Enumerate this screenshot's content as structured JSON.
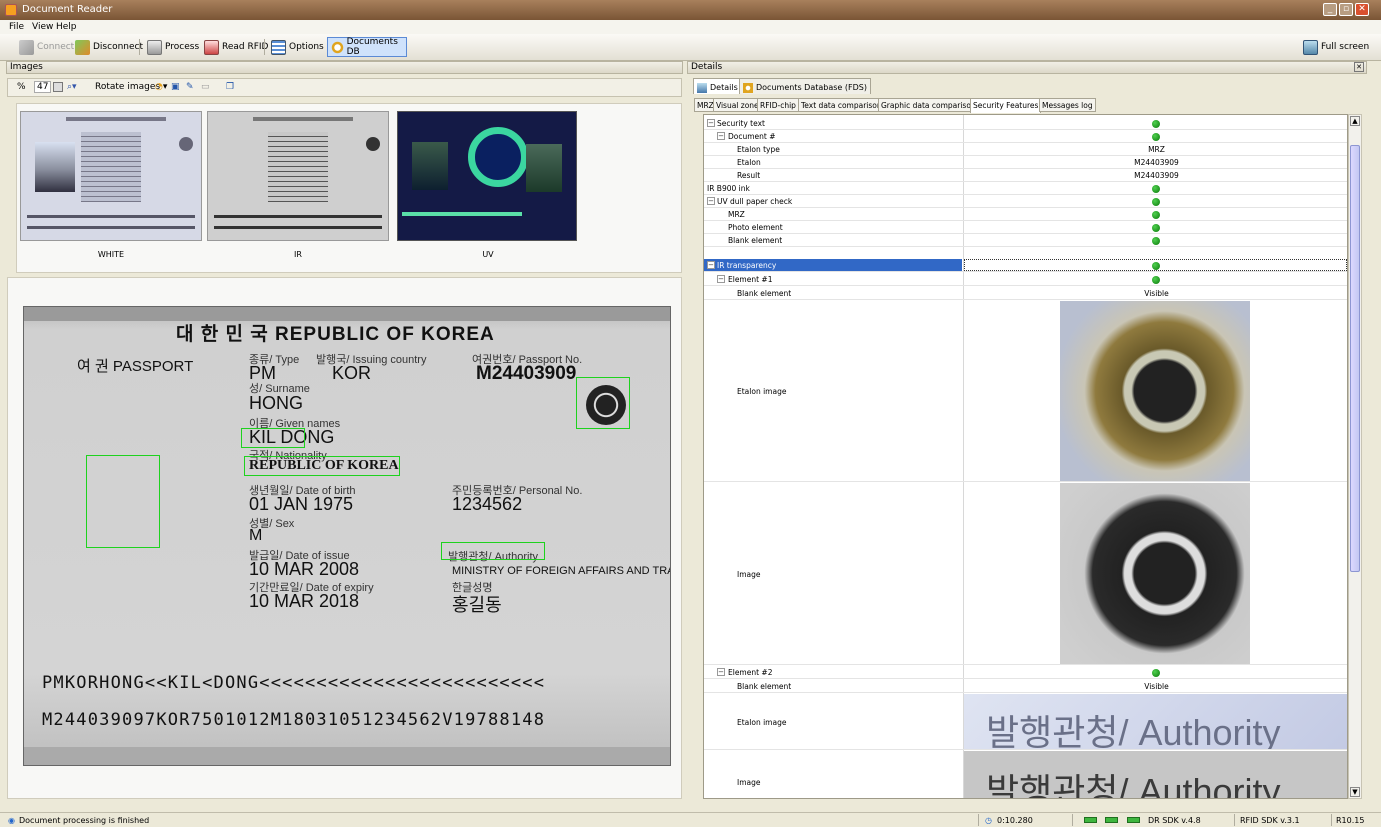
{
  "window": {
    "title": "Document Reader"
  },
  "menu": [
    "File",
    "View",
    "Help"
  ],
  "toolbar": {
    "connect": "Connect",
    "disconnect": "Disconnect",
    "process": "Process",
    "read_rfid": "Read RFID",
    "options": "Options",
    "documents_db": "Documents DB",
    "full_screen": "Full screen"
  },
  "images_panel": {
    "title": "Images",
    "zoom_prefix": "%",
    "zoom_value": "47",
    "rotate_label": "Rotate images ▾",
    "thumbnails": [
      {
        "label": "WHITE"
      },
      {
        "label": "IR"
      },
      {
        "label": "UV"
      }
    ]
  },
  "passport": {
    "country_header": "대 한 민 국   REPUBLIC OF KOREA",
    "doc_title": "여 권  PASSPORT",
    "type_label": "종류/ Type",
    "type_value": "PM",
    "issuing_label": "발행국/ Issuing country",
    "issuing_value": "KOR",
    "passport_no_label": "여권번호/ Passport No.",
    "passport_no_value": "M24403909",
    "surname_label": "성/ Surname",
    "surname_value": "HONG",
    "given_label": "이름/ Given names",
    "given_value": "KIL DONG",
    "nationality_label": "국적/ Nationality",
    "nationality_value": "REPUBLIC OF KOREA",
    "dob_label": "생년월일/ Date of birth",
    "dob_value": "01 JAN 1975",
    "personal_label": "주민등록번호/ Personal No.",
    "personal_value": "1234562",
    "sex_label": "성별/ Sex",
    "sex_value": "M",
    "issue_label": "발급일/ Date of issue",
    "issue_value": "10 MAR 2008",
    "authority_label": "발행관청/ Authority",
    "authority_value": "MINISTRY OF FOREIGN AFFAIRS AND TRADE",
    "expiry_label": "기간만료일/ Date of expiry",
    "expiry_value": "10 MAR 2018",
    "korean_name_label": "한글성명",
    "korean_name_value": "홍길동",
    "mrz1": "PMKORHONG<<KIL<DONG<<<<<<<<<<<<<<<<<<<<<<<<<",
    "mrz2": "M244039097KOR7501012M18031051234562V19788148"
  },
  "details_panel": {
    "title": "Details",
    "tabs": [
      "Details",
      "Documents Database (FDS)"
    ],
    "subtabs": [
      "MRZ",
      "Visual zone",
      "RFID-chip",
      "Text data comparison",
      "Graphic data comparison",
      "Security Features",
      "Messages log"
    ],
    "rows": [
      {
        "label": "Security text",
        "value": "",
        "ok": true
      },
      {
        "label": "Document #",
        "value": "",
        "ok": true
      },
      {
        "label": "Etalon type",
        "value": "MRZ",
        "ok": false
      },
      {
        "label": "Etalon",
        "value": "M24403909",
        "ok": false
      },
      {
        "label": "Result",
        "value": "M24403909",
        "ok": false
      },
      {
        "label": "IR B900 ink",
        "value": "",
        "ok": true
      },
      {
        "label": "UV dull paper check",
        "value": "",
        "ok": true
      },
      {
        "label": "MRZ",
        "value": "",
        "ok": true
      },
      {
        "label": "Photo element",
        "value": "",
        "ok": true
      },
      {
        "label": "Blank element",
        "value": "",
        "ok": true
      },
      {
        "label": "IR transparency",
        "value": "",
        "ok": true
      },
      {
        "label": "Element #1",
        "value": "",
        "ok": true
      },
      {
        "label": "Blank element",
        "value": "Visible",
        "ok": false
      },
      {
        "label": "Etalon image",
        "value": "",
        "ok": false
      },
      {
        "label": "Image",
        "value": "",
        "ok": false
      },
      {
        "label": "Element #2",
        "value": "",
        "ok": true
      },
      {
        "label": "Blank element",
        "value": "Visible",
        "ok": false
      },
      {
        "label": "Etalon image",
        "value": "",
        "ok": false
      },
      {
        "label": "Image",
        "value": "",
        "ok": false
      }
    ],
    "authority_snippet": "발행관청/ Authority"
  },
  "status": {
    "message": "Document processing is finished",
    "timer": "0:10.280",
    "dr_sdk": "DR SDK v.4.8",
    "rfid_sdk": "RFID SDK v.3.1",
    "revision": "R10.15"
  }
}
